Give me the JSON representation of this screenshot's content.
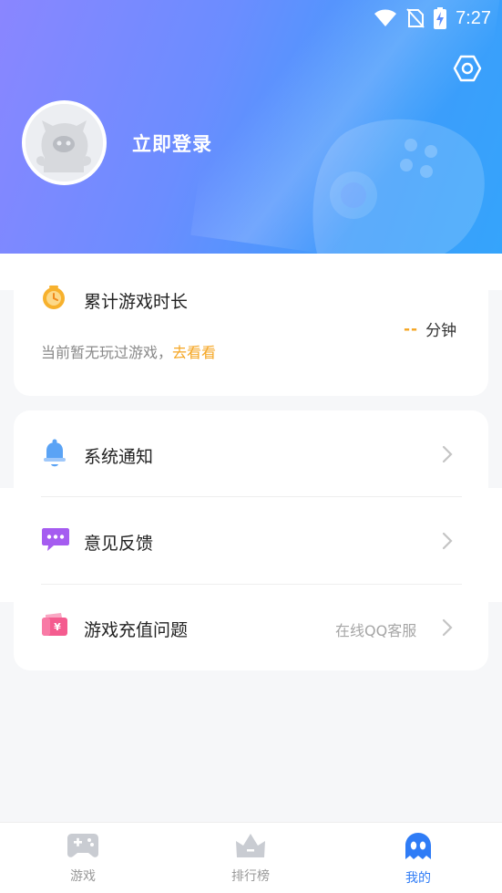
{
  "status_bar": {
    "time": "7:27",
    "icons": [
      "wifi-icon",
      "no-sim-icon",
      "battery-charging-icon"
    ]
  },
  "header": {
    "login_text": "立即登录",
    "settings_icon": "settings-hexagon-icon",
    "avatar_icon": "default-avatar-icon"
  },
  "playtime": {
    "title": "累计游戏时长",
    "value": "--",
    "unit": "分钟",
    "subtitle_prefix": "当前暂无玩过游戏，",
    "subtitle_link": "去看看"
  },
  "menu": {
    "items": [
      {
        "label": "系统通知",
        "icon": "bell-icon",
        "right_text": ""
      },
      {
        "label": "意见反馈",
        "icon": "chat-bubble-icon",
        "right_text": ""
      },
      {
        "label": "游戏充值问题",
        "icon": "recharge-wallet-icon",
        "right_text": "在线QQ客服"
      }
    ]
  },
  "bottom_nav": {
    "items": [
      {
        "label": "游戏",
        "icon": "gamepad-icon",
        "active": false
      },
      {
        "label": "排行榜",
        "icon": "crown-icon",
        "active": false
      },
      {
        "label": "我的",
        "icon": "ghost-icon",
        "active": true
      }
    ]
  },
  "colors": {
    "accent": "#2f7cf6",
    "link": "#f5a623",
    "header_start": "#8a86ff",
    "header_end": "#35a4fb"
  }
}
